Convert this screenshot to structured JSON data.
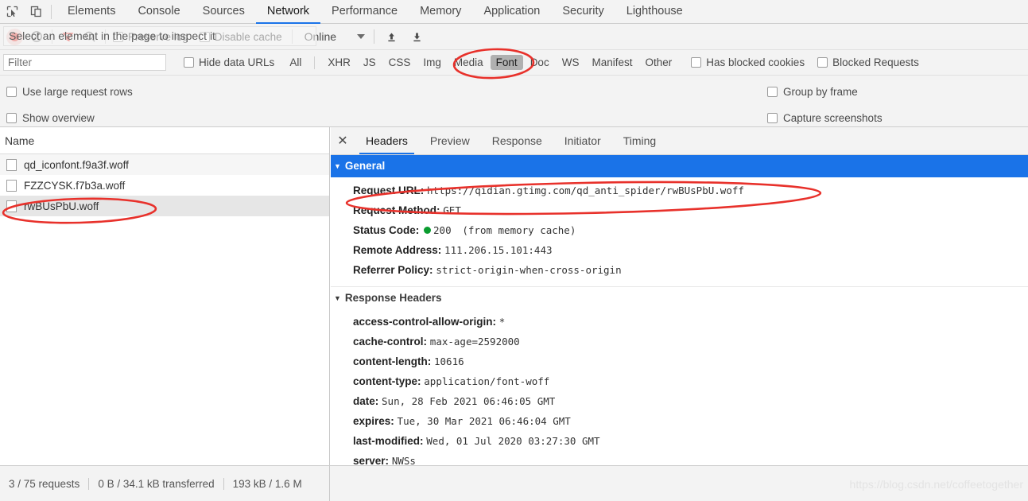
{
  "window": {
    "devtools_tabs": [
      {
        "label": "Elements",
        "active": false
      },
      {
        "label": "Console",
        "active": false
      },
      {
        "label": "Sources",
        "active": false
      },
      {
        "label": "Network",
        "active": true
      },
      {
        "label": "Performance",
        "active": false
      },
      {
        "label": "Memory",
        "active": false
      },
      {
        "label": "Application",
        "active": false
      },
      {
        "label": "Security",
        "active": false
      },
      {
        "label": "Lighthouse",
        "active": false
      }
    ],
    "inspect_icon": "inspect-element-icon",
    "device_icon": "device-toolbar-icon"
  },
  "toolbar": {
    "record_icon": "record-icon",
    "clear_icon": "clear-icon",
    "filter_icon": "filter-funnel-icon",
    "search_icon": "search-icon",
    "preserve_log_label": "Preserve log",
    "disable_cache_label": "Disable cache",
    "throttle_value": "Online",
    "upload_icon": "import-har-icon",
    "download_icon": "export-har-icon",
    "tooltip_text": "Select an element in the page to inspect it"
  },
  "filter_bar": {
    "filter_placeholder": "Filter",
    "filter_value": "",
    "hide_data_urls_label": "Hide data URLs",
    "types": [
      {
        "label": "All",
        "selected": false
      },
      {
        "label": "XHR",
        "selected": false
      },
      {
        "label": "JS",
        "selected": false
      },
      {
        "label": "CSS",
        "selected": false
      },
      {
        "label": "Img",
        "selected": false
      },
      {
        "label": "Media",
        "selected": false
      },
      {
        "label": "Font",
        "selected": true
      },
      {
        "label": "Doc",
        "selected": false
      },
      {
        "label": "WS",
        "selected": false
      },
      {
        "label": "Manifest",
        "selected": false
      },
      {
        "label": "Other",
        "selected": false
      }
    ],
    "has_blocked_cookies_label": "Has blocked cookies",
    "blocked_requests_label": "Blocked Requests"
  },
  "options": {
    "use_large_request_rows": "Use large request rows",
    "show_overview": "Show overview",
    "group_by_frame": "Group by frame",
    "capture_screenshots": "Capture screenshots"
  },
  "request_list": {
    "column_header": "Name",
    "rows": [
      {
        "name": "qd_iconfont.f9a3f.woff",
        "selected": false
      },
      {
        "name": "FZZCYSK.f7b3a.woff",
        "selected": false
      },
      {
        "name": "rwBUsPbU.woff",
        "selected": true
      }
    ]
  },
  "details": {
    "close_icon": "close-icon",
    "tabs": [
      {
        "label": "Headers",
        "active": true
      },
      {
        "label": "Preview",
        "active": false
      },
      {
        "label": "Response",
        "active": false
      },
      {
        "label": "Initiator",
        "active": false
      },
      {
        "label": "Timing",
        "active": false
      }
    ],
    "general": {
      "title": "General",
      "rows": [
        {
          "key": "Request URL:",
          "value": "https://qidian.gtimg.com/qd_anti_spider/rwBUsPbU.woff"
        },
        {
          "key": "Request Method:",
          "value": "GET"
        },
        {
          "key": "Status Code:",
          "value": "200",
          "status_dot": true,
          "note": "(from memory cache)"
        },
        {
          "key": "Remote Address:",
          "value": "111.206.15.101:443"
        },
        {
          "key": "Referrer Policy:",
          "value": "strict-origin-when-cross-origin"
        }
      ]
    },
    "response_headers": {
      "title": "Response Headers",
      "rows": [
        {
          "key": "access-control-allow-origin:",
          "value": "*"
        },
        {
          "key": "cache-control:",
          "value": "max-age=2592000"
        },
        {
          "key": "content-length:",
          "value": "10616"
        },
        {
          "key": "content-type:",
          "value": "application/font-woff"
        },
        {
          "key": "date:",
          "value": "Sun, 28 Feb 2021 06:46:05 GMT"
        },
        {
          "key": "expires:",
          "value": "Tue, 30 Mar 2021 06:46:04 GMT"
        },
        {
          "key": "last-modified:",
          "value": "Wed, 01 Jul 2020 03:27:30 GMT"
        },
        {
          "key": "server:",
          "value": "NWSs"
        }
      ]
    }
  },
  "status_bar": {
    "requests": "3 / 75 requests",
    "transferred": "0 B / 34.1 kB transferred",
    "resources": "193 kB / 1.6 M"
  },
  "watermark": "https://blog.csdn.net/coffeetogether",
  "colors": {
    "accent_blue": "#1a73e8",
    "annotation_red": "#e8312b",
    "status_green": "#0a9c2f",
    "chrome_bg": "#f3f3f3"
  }
}
